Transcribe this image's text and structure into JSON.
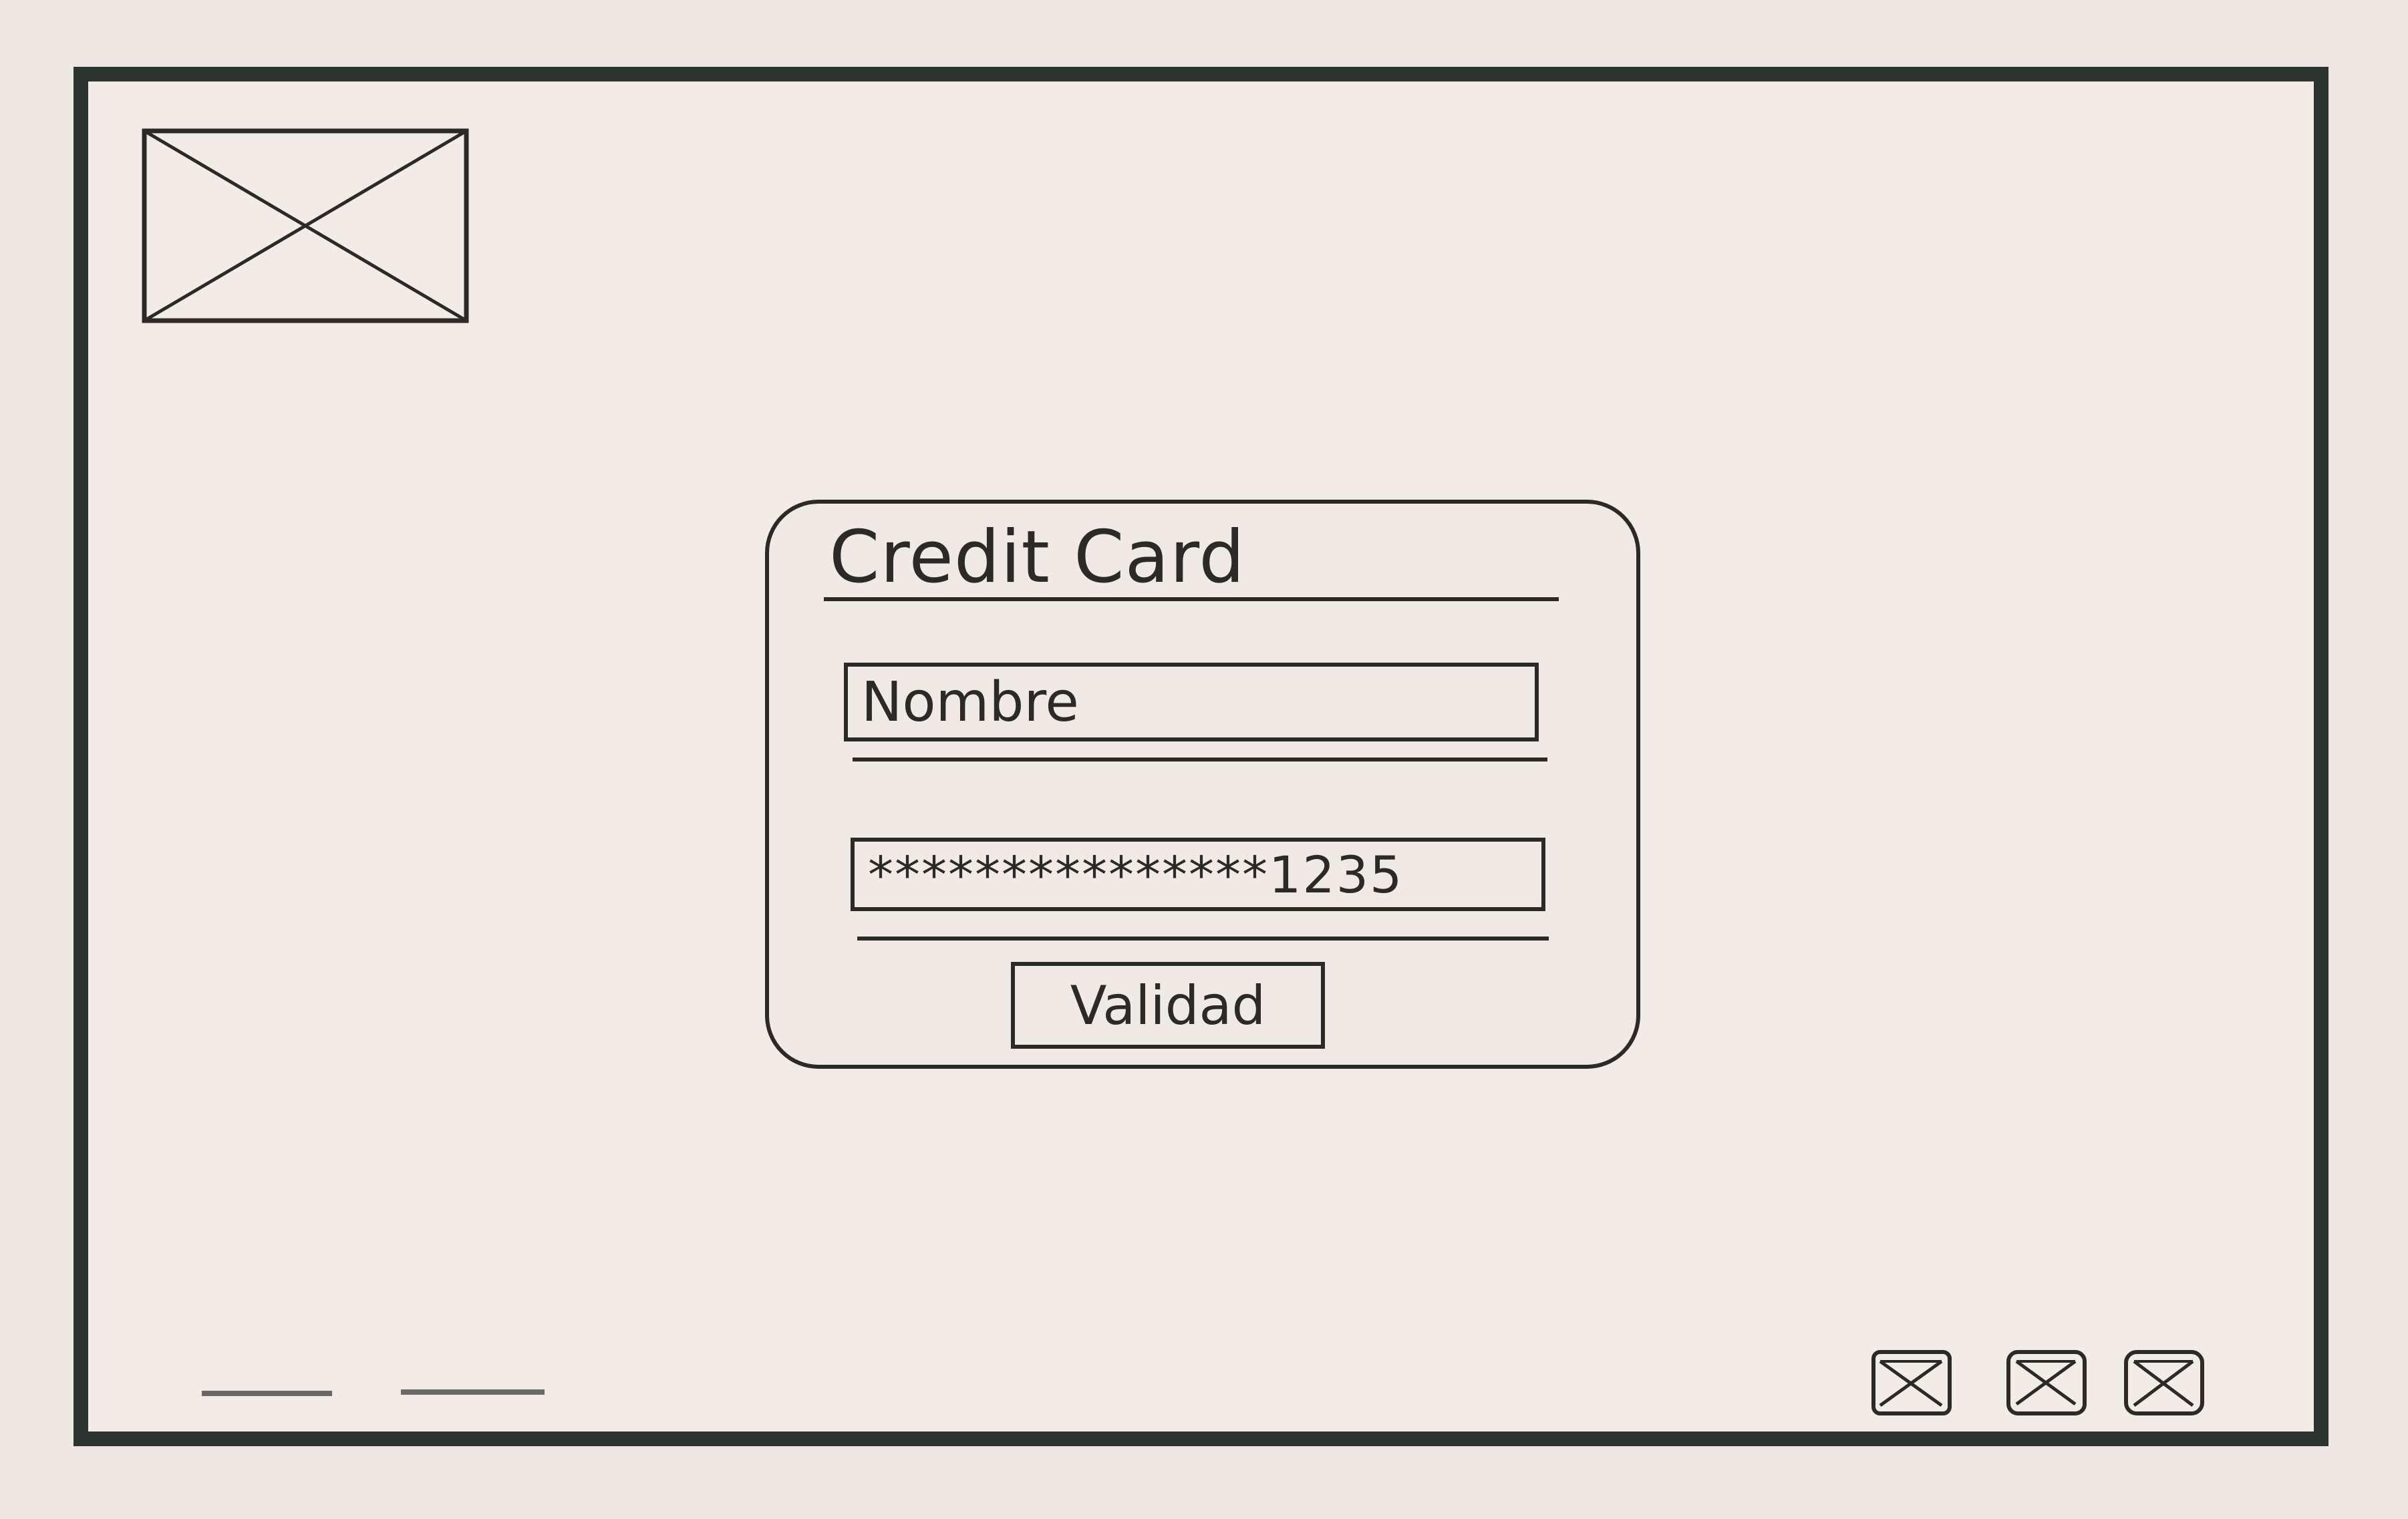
{
  "dialog": {
    "title": "Credit Card",
    "name_field": {
      "value": "Nombre"
    },
    "card_field": {
      "value": "***************1235"
    },
    "validate_label": "Validad"
  },
  "icons": {
    "header_image": "image-placeholder-icon",
    "footer_buttons": [
      "image-placeholder-icon",
      "image-placeholder-icon",
      "image-placeholder-icon"
    ]
  },
  "colors": {
    "frame": "#2c342f",
    "ink": "#2b2a27",
    "paper": "#efe7e1"
  }
}
